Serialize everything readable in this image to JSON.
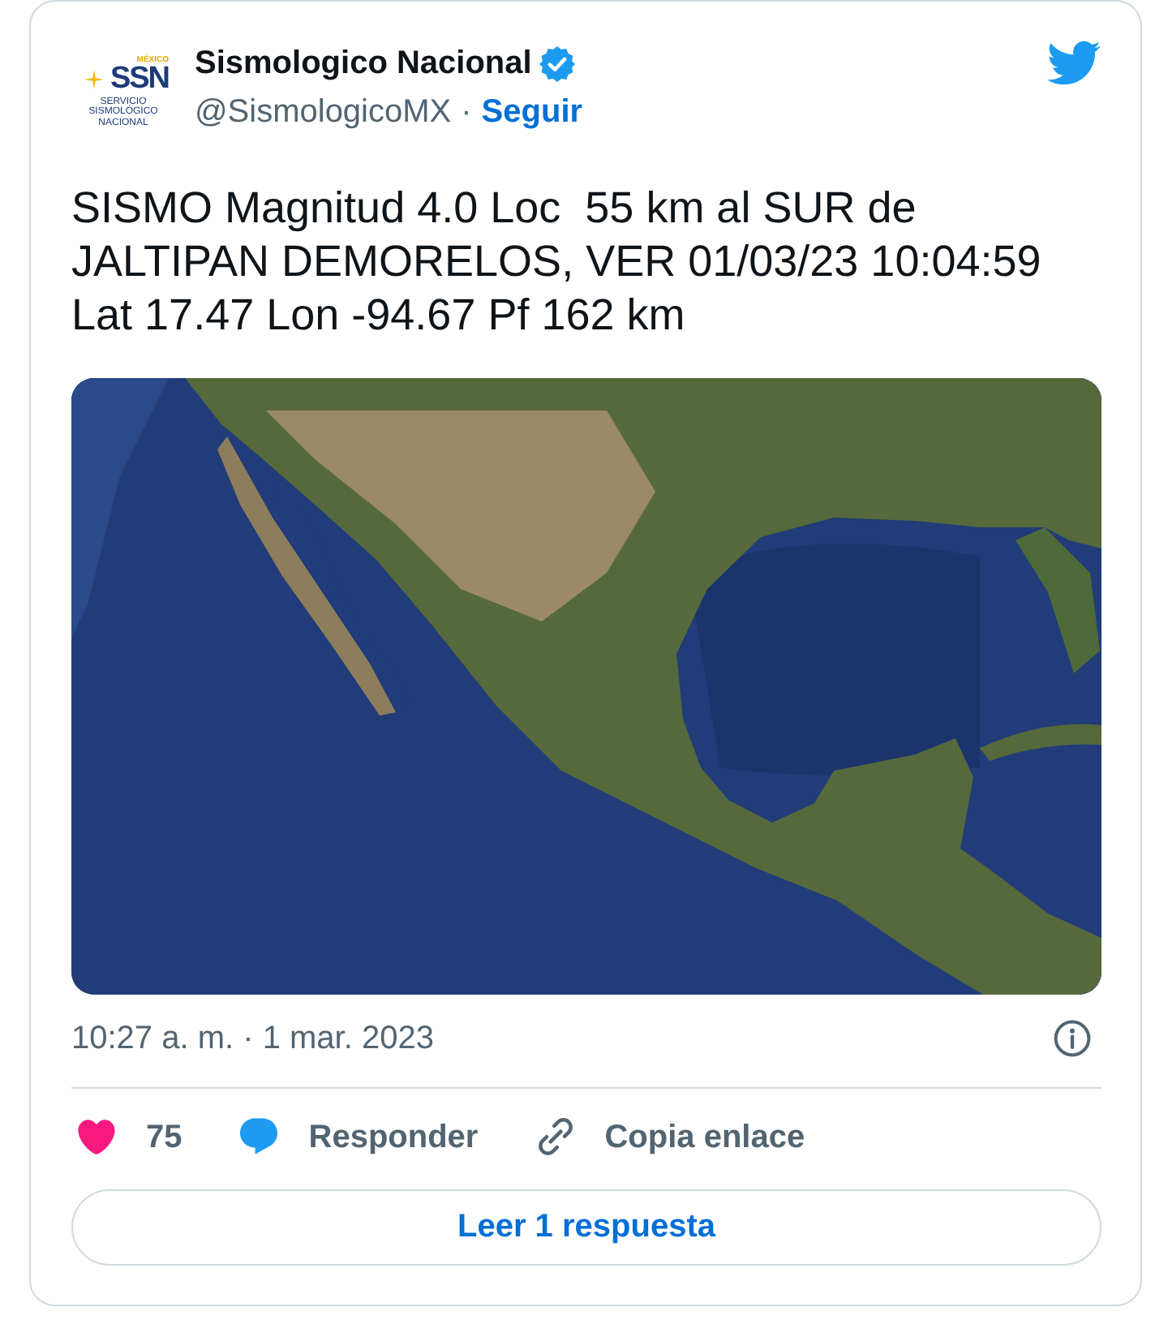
{
  "author": {
    "name": "Sismologico Nacional",
    "verified": true,
    "handle": "@SismologicoMX",
    "separator": "·",
    "follow_label": "Seguir",
    "avatar": {
      "logo_top": "MÉXICO",
      "logo_text": "SSN",
      "logo_subtitle": "SERVICIO SISMOLÓGICO NACIONAL"
    }
  },
  "tweet": {
    "text": "SISMO Magnitud 4.0 Loc  55 km al SUR de JALTIPAN DEMORELOS, VER 01/03/23 10:04:59 Lat 17.47 Lon -94.67 Pf 162 km"
  },
  "timestamp": "10:27 a. m. · 1 mar. 2023",
  "actions": [
    {
      "kind": "like",
      "label": "75"
    },
    {
      "kind": "reply",
      "label": "Responder"
    },
    {
      "kind": "copy-link",
      "label": "Copia enlace"
    }
  ],
  "read_replies_button": "Leer 1 respuesta"
}
